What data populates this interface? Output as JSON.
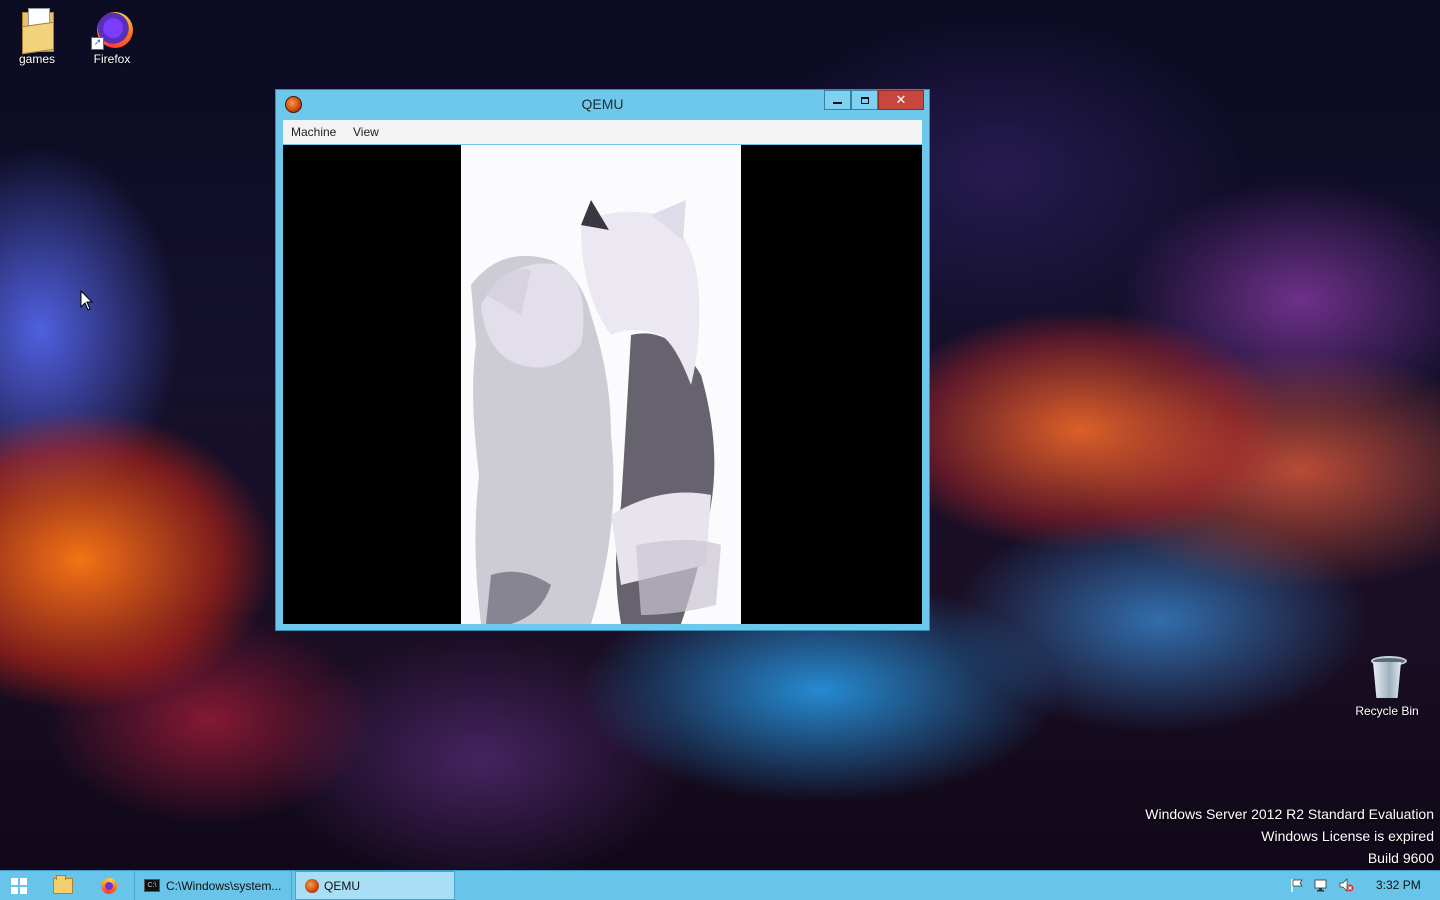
{
  "desktop": {
    "icons": [
      {
        "label": "games"
      },
      {
        "label": "Firefox"
      },
      {
        "label": "Recycle Bin"
      }
    ],
    "watermark": {
      "line1": "Windows Server 2012 R2 Standard Evaluation",
      "line2": "Windows License is expired",
      "line3": "Build 9600"
    }
  },
  "window": {
    "title": "QEMU",
    "menu": [
      "Machine",
      "View"
    ],
    "controls": {
      "minimize": "minimize",
      "maximize": "maximize",
      "close": "✕"
    }
  },
  "taskbar": {
    "pinned": [
      "start-button",
      "file-explorer",
      "firefox"
    ],
    "tasks": [
      {
        "label": "C:\\Windows\\system...",
        "icon": "cmd-icon"
      },
      {
        "label": "QEMU",
        "icon": "qemu-icon",
        "active": true
      }
    ],
    "tray_icons": [
      "action-center-flag-icon",
      "network-icon",
      "volume-icon"
    ],
    "clock": "3:32 PM"
  },
  "colors": {
    "taskbar": "#68c4e9",
    "window_frame": "#6ec8ec",
    "close_button": "#c7463d"
  }
}
